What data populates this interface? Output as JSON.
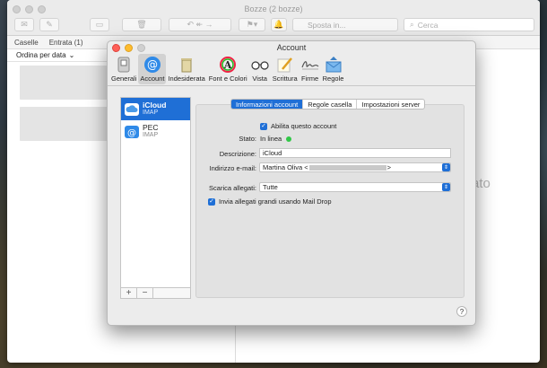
{
  "mail": {
    "title": "Bozze (2 bozze)",
    "send_label": "Sposta in...",
    "search_placeholder": "Cerca",
    "favorites": [
      "Caselle",
      "Entrata (1)"
    ],
    "sort_label": "Ordina per data",
    "placeholder_fragment": "ato"
  },
  "prefs": {
    "title": "Account",
    "toolbar": [
      {
        "label": "Generali",
        "icon": "switch-icon"
      },
      {
        "label": "Account",
        "icon": "at-icon"
      },
      {
        "label": "Indesiderata",
        "icon": "trash-icon"
      },
      {
        "label": "Font e Colori",
        "icon": "font-icon"
      },
      {
        "label": "Vista",
        "icon": "glasses-icon"
      },
      {
        "label": "Scrittura",
        "icon": "pencil-icon"
      },
      {
        "label": "Firme",
        "icon": "signature-icon"
      },
      {
        "label": "Regole",
        "icon": "envelope-icon"
      }
    ],
    "accounts": [
      {
        "name": "iCloud",
        "type": "IMAP"
      },
      {
        "name": "PEC",
        "type": "IMAP"
      }
    ],
    "tabs": [
      "Informazioni account",
      "Regole casella",
      "Impostazioni server"
    ],
    "form": {
      "enable_label": "Abilita questo account",
      "status_label": "Stato:",
      "status_value": "In linea",
      "description_label": "Descrizione:",
      "description_value": "iCloud",
      "email_label": "Indirizzo e-mail:",
      "email_prefix": "Martina Oliva <",
      "email_suffix": ">",
      "download_label": "Scarica allegati:",
      "download_value": "Tutte",
      "maildrop_label": "Invia allegati grandi usando Mail Drop"
    },
    "help": "?"
  },
  "colors": {
    "accent": "#1f6fd6",
    "online": "#31c747"
  }
}
